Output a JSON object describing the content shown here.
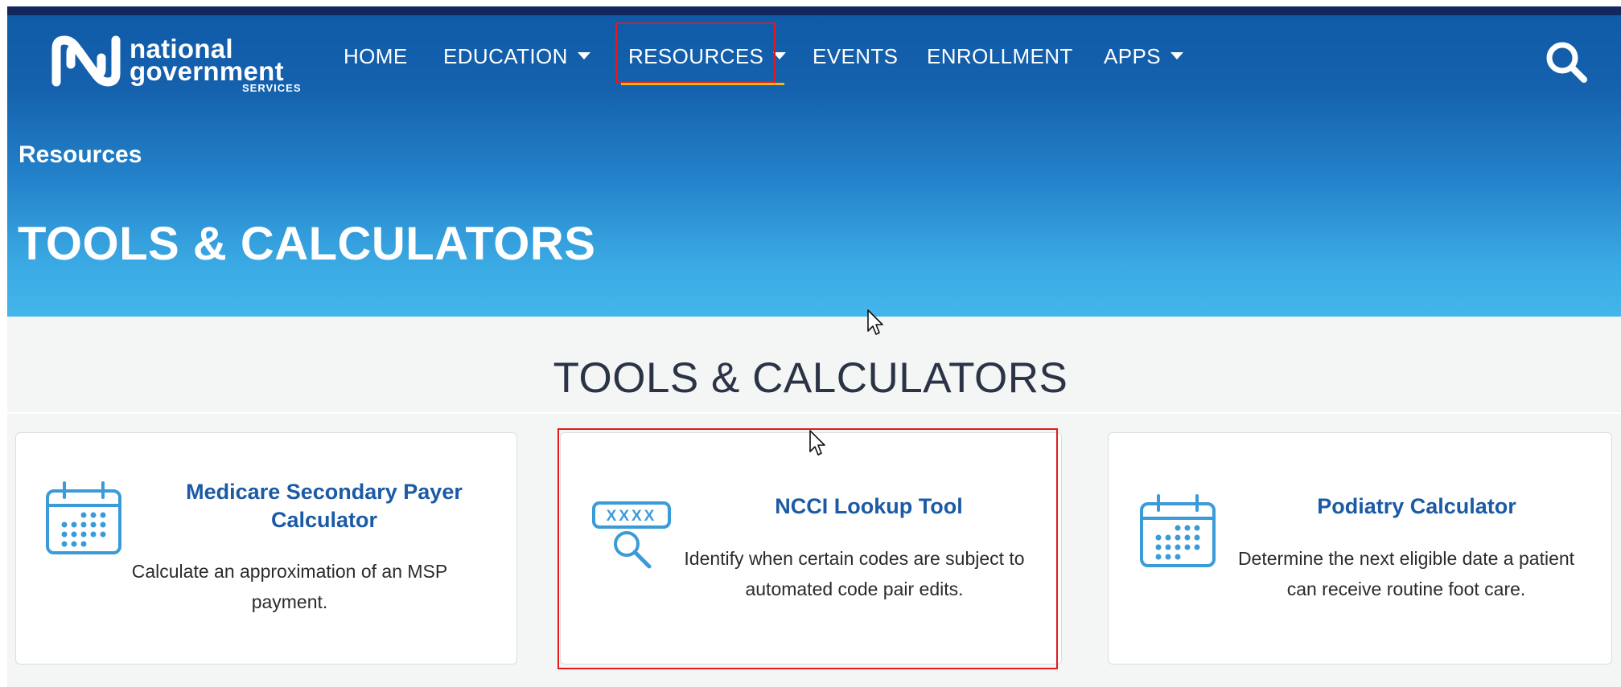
{
  "header": {
    "logo": {
      "line1": "national",
      "line2": "government",
      "line3": "SERVICES"
    },
    "nav": [
      {
        "label": "HOME",
        "has_caret": false
      },
      {
        "label": "EDUCATION",
        "has_caret": true
      },
      {
        "label": "RESOURCES",
        "has_caret": true,
        "active": true
      },
      {
        "label": "EVENTS",
        "has_caret": false
      },
      {
        "label": "ENROLLMENT",
        "has_caret": false
      },
      {
        "label": "APPS",
        "has_caret": true
      }
    ],
    "search_icon": "search-icon"
  },
  "hero": {
    "breadcrumb": "Resources",
    "title": "TOOLS & CALCULATORS"
  },
  "main": {
    "section_title": "TOOLS & CALCULATORS",
    "cards": [
      {
        "icon": "calendar-icon",
        "title": "Medicare Secondary Payer Calculator",
        "description": "Calculate an approximation of an MSP payment."
      },
      {
        "icon": "code-lookup-icon",
        "title": "NCCI Lookup Tool",
        "description": "Identify when certain codes are subject to automated code pair edits.",
        "icon_text": "XXXX"
      },
      {
        "icon": "calendar-icon",
        "title": "Podiatry Calculator",
        "description": "Determine the next eligible date a patient can receive routine foot care."
      }
    ]
  },
  "colors": {
    "header_dark": "#13275f",
    "hero_top": "#0f5ba8",
    "hero_bottom": "#43b6ea",
    "active_underline": "#f2b31b",
    "card_title": "#1b5aa5",
    "icon_blue": "#3a9bd8",
    "highlight_red": "#e3191c"
  }
}
